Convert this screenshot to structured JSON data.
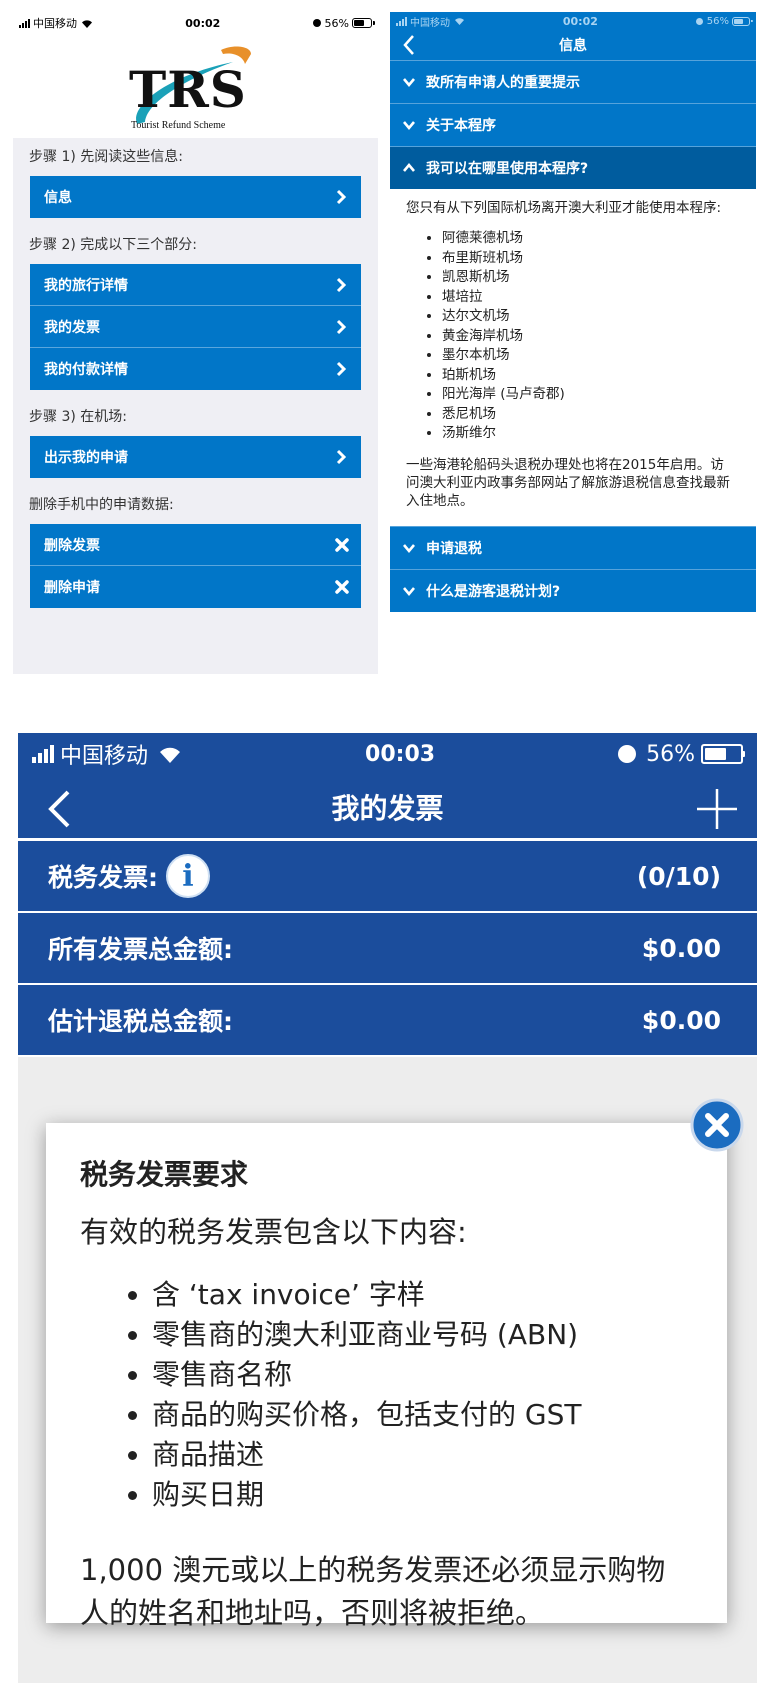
{
  "panelA": {
    "status": {
      "carrier": "中国移动",
      "time": "00:02",
      "battery_text": "56%",
      "battery_level": 0.56
    },
    "logo": {
      "text": "TRS",
      "subtitle": "Tourist Refund Scheme"
    },
    "step1": "步骤 1) 先阅读这些信息:",
    "info_button": "信息",
    "step2": "步骤 2) 完成以下三个部分:",
    "section_buttons": [
      "我的旅行详情",
      "我的发票",
      "我的付款详情"
    ],
    "step3": "步骤 3) 在机场:",
    "show_button": "出示我的申请",
    "delete_label": "删除手机中的申请数据:",
    "delete_buttons": [
      "删除发票",
      "删除申请"
    ]
  },
  "panelB": {
    "status": {
      "carrier": "中国移动",
      "time": "00:02",
      "battery_text": "56%"
    },
    "title": "信息",
    "accordions_top": [
      "致所有申请人的重要提示",
      "关于本程序"
    ],
    "active_accordion": "我可以在哪里使用本程序?",
    "intro": "您只有从下列国际机场离开澳大利亚才能使用本程序:",
    "airports": [
      "阿德莱德机场",
      "布里斯班机场",
      "凯恩斯机场",
      "堪培拉",
      "达尔文机场",
      "黄金海岸机场",
      "墨尔本机场",
      "珀斯机场",
      "阳光海岸 (马卢奇郡)",
      "悉尼机场",
      "汤斯维尔"
    ],
    "note": "一些海港轮船码头退税办理处也将在2015年启用。访问澳大利亚内政事务部网站了解旅游退税信息查找最新入住地点。",
    "accordions_bottom": [
      "申请退税",
      "什么是游客退税计划?"
    ]
  },
  "panelC": {
    "status": {
      "carrier": "中国移动",
      "time": "00:03",
      "battery_text": "56%",
      "battery_level": 0.56
    },
    "title": "我的发票",
    "rows": [
      {
        "label": "税务发票:",
        "value": "(0/10)"
      },
      {
        "label": "所有发票总金额:",
        "value": "$0.00"
      },
      {
        "label": "估计退税总金额:",
        "value": "$0.00"
      }
    ],
    "modal": {
      "title": "税务发票要求",
      "intro": "有效的税务发票包含以下内容:",
      "items": [
        "含 ‘tax invoice’ 字样",
        "零售商的澳大利亚商业号码 (ABN)",
        "零售商名称",
        "商品的购买价格，包括支付的 GST",
        "商品描述",
        "购买日期"
      ],
      "footer": "1,000 澳元或以上的税务发票还必须显示购物人的姓名和地址吗，否则将被拒绝。"
    }
  },
  "colors": {
    "trs_blue": "#0176c8",
    "trs_dark_blue": "#005c9e",
    "invoice_navy": "#1b4d9c",
    "logo_orange": "#e8902a",
    "logo_teal": "#1aa1b8"
  }
}
